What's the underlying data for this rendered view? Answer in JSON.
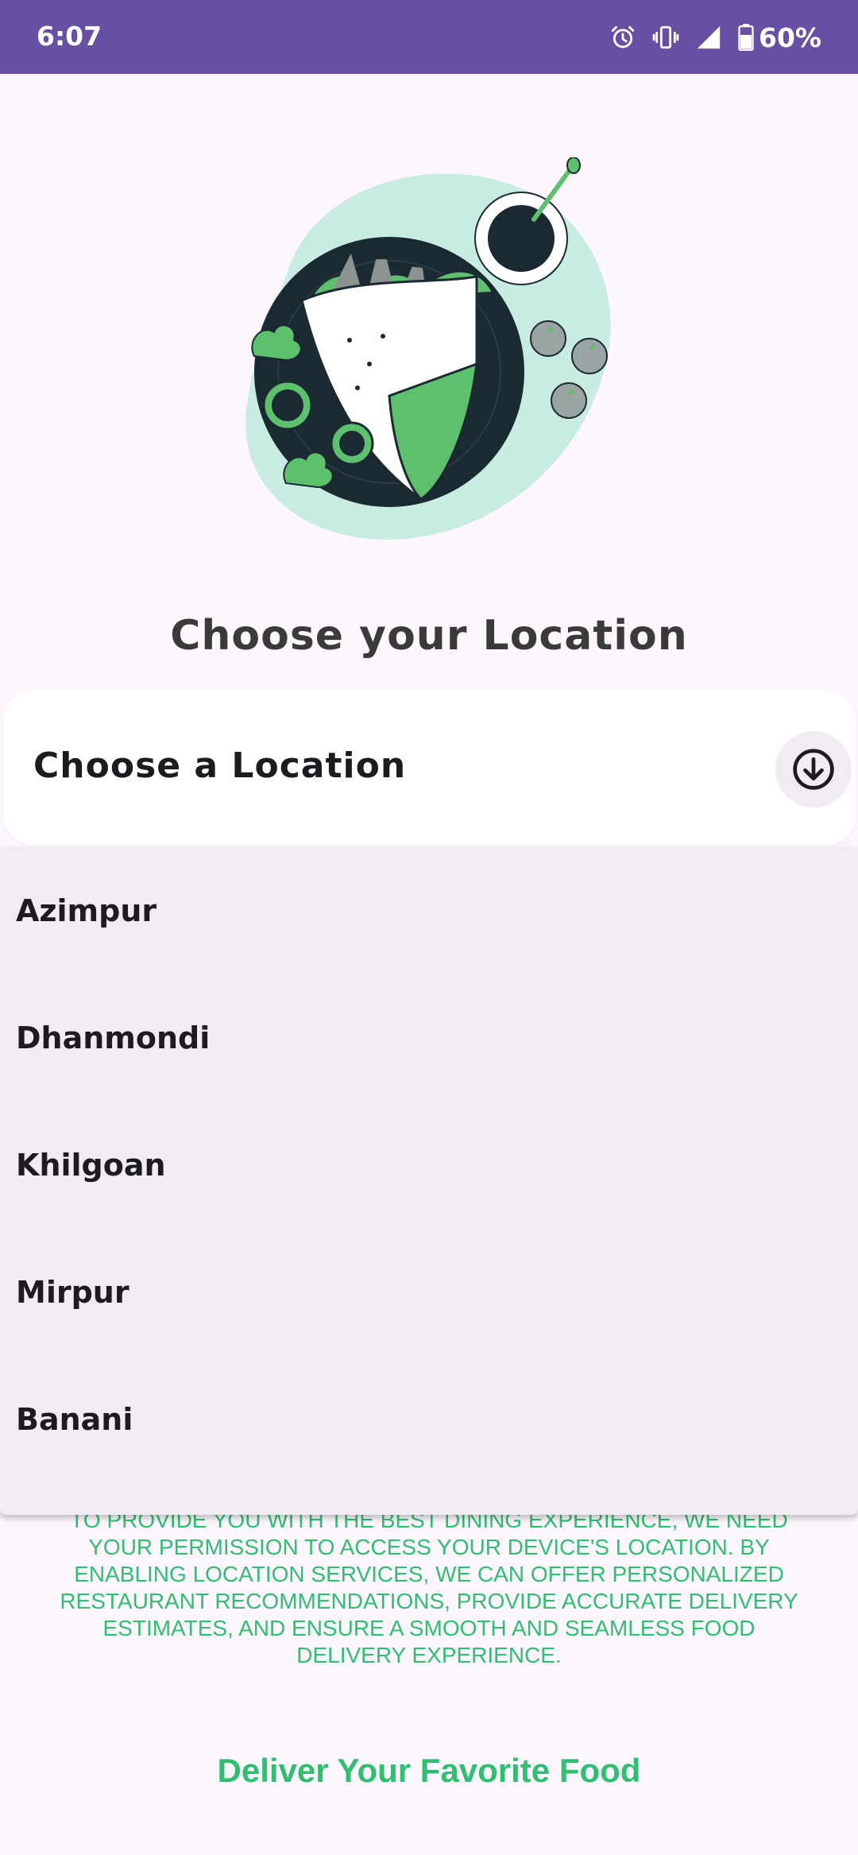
{
  "status_bar": {
    "time": "6:07",
    "battery_percent": "60%",
    "icons": [
      "alarm-icon",
      "vibrate-icon",
      "signal-icon",
      "battery-icon"
    ]
  },
  "illustration": {
    "name": "food-wrap-illustration"
  },
  "page": {
    "title": "Choose your Location"
  },
  "location_selector": {
    "label": "Choose a Location",
    "dropdown_icon": "arrow-down-circle-icon",
    "options": [
      "Azimpur",
      "Dhanmondi",
      "Khilgoan",
      "Mirpur",
      "Banani"
    ]
  },
  "permission": {
    "text": "To provide you with the best dining experience, we need your permission to access your device's location. By enabling location services, we can offer personalized restaurant recommendations, provide accurate delivery estimates, and ensure a smooth and seamless food delivery experience."
  },
  "footer": {
    "tagline": "Deliver Your Favorite Food"
  },
  "colors": {
    "status_bar": "#6750a4",
    "accent_green": "#2fbf71",
    "background": "#fdf7fd",
    "menu_background": "#f1ecf4"
  }
}
